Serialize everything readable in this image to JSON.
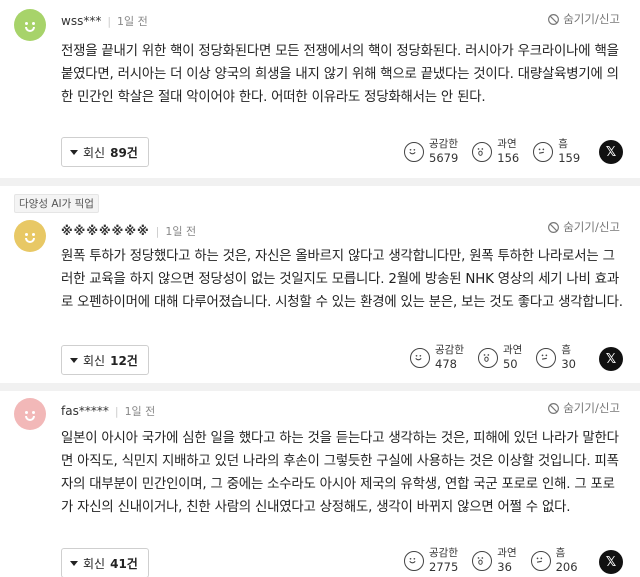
{
  "comments": [
    {
      "nick": "wss***",
      "time": "1일 전",
      "hide_label": "숨기기/신고",
      "text": "전쟁을 끝내기 위한 핵이 정당화된다면 모든 전쟁에서의 핵이 정당화된다. 러시아가 우크라이나에 핵을 붙였다면, 러시아는 더 이상 양국의 희생을 내지 않기 위해 핵으로 끝냈다는 것이다. 대량살육병기에 의한 민간인 학살은 절대 악이어야 한다. 어떠한 이유라도 정당화해서는 안 된다.",
      "reply_label": "회신",
      "reply_count": "89건",
      "reactions": [
        {
          "name": "공감한",
          "count": "5679"
        },
        {
          "name": "과연",
          "count": "156"
        },
        {
          "name": "흠",
          "count": "159"
        }
      ],
      "avatar_color": "#a7d36a"
    },
    {
      "pick_label": "다양성 AI가 픽업",
      "nick": "※※※※※※※",
      "time": "1일 전",
      "hide_label": "숨기기/신고",
      "text": "원폭 투하가 정당했다고 하는 것은, 자신은 올바르지 않다고 생각합니다만, 원폭 투하한 나라로서는 그러한 교육을 하지 않으면 정당성이 없는 것일지도 모릅니다. 2월에 방송된 NHK 영상의 세기 나비 효과로 오펜하이머에 대해 다루어졌습니다. 시청할 수 있는 환경에 있는 분은, 보는 것도 좋다고 생각합니다.",
      "reply_label": "회신",
      "reply_count": "12건",
      "reactions": [
        {
          "name": "공감한",
          "count": "478"
        },
        {
          "name": "과연",
          "count": "50"
        },
        {
          "name": "흠",
          "count": "30"
        }
      ],
      "avatar_color": "#e8c865"
    },
    {
      "nick": "fas*****",
      "time": "1일 전",
      "hide_label": "숨기기/신고",
      "text": "일본이 아시아 국가에 심한 일을 했다고 하는 것을 듣는다고 생각하는 것은, 피해에 있던 나라가 말한다면 아직도, 식민지 지배하고 있던 나라의 후손이 그렇듯한 구실에 사용하는 것은 이상할 것입니다. 피폭자의 대부분이 민간인이며, 그 중에는 소수라도 아시아 제국의 유학생, 연합 국군 포로로 인해. 그 포로가 자신의 신내이거나, 친한 사람의 신내였다고 상정해도, 생각이 바뀌지 않으면 어쩔 수 없다.",
      "reply_label": "회신",
      "reply_count": "41건",
      "reactions": [
        {
          "name": "공감한",
          "count": "2775"
        },
        {
          "name": "과연",
          "count": "36"
        },
        {
          "name": "흠",
          "count": "206"
        }
      ],
      "avatar_color": "#f2b8b8"
    }
  ],
  "share_icon": "x-logo"
}
